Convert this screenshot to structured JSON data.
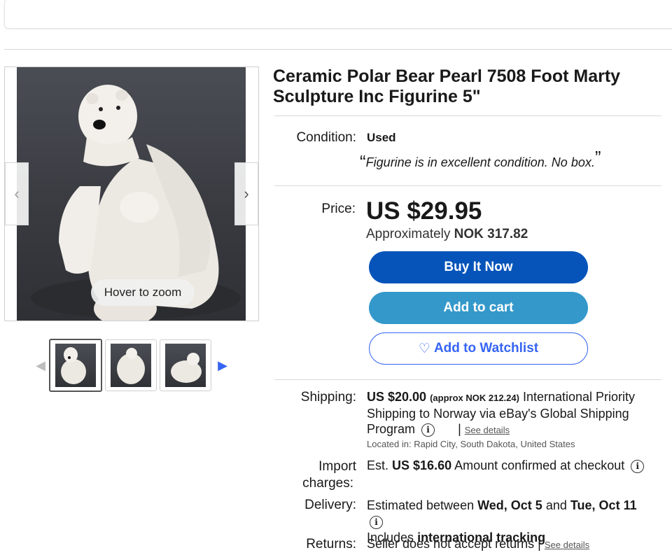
{
  "item": {
    "title": "Ceramic Polar Bear Pearl 7508 Foot Marty Sculpture Inc Figurine 5\""
  },
  "gallery": {
    "zoom_hint": "Hover to zoom",
    "prev_icon": "chevron-left-icon",
    "next_icon": "chevron-right-icon",
    "thumbnail_count": 3
  },
  "condition": {
    "label": "Condition:",
    "value": "Used",
    "note": "Figurine is in excellent condition. No box.",
    "open_quote": "“",
    "close_quote": "”"
  },
  "price": {
    "label": "Price:",
    "amount": "US $29.95",
    "approx_prefix": "Approximately",
    "approx_value": "NOK 317.82"
  },
  "buttons": {
    "buy_now": "Buy It Now",
    "add_to_cart": "Add to cart",
    "add_to_watchlist": "Add to Watchlist"
  },
  "shipping": {
    "label": "Shipping:",
    "amount": "US $20.00",
    "approx": "(approx NOK 212.24)",
    "service": "International Priority Shipping to Norway via eBay's Global Shipping Program",
    "see_details": "See details",
    "separator": "|",
    "location": "Located in: Rapid City, South Dakota, United States"
  },
  "import_charges": {
    "label_line1": "Import",
    "label_line2": "charges:",
    "est_prefix": "Est.",
    "amount": "US $16.60",
    "suffix": "Amount confirmed at checkout"
  },
  "delivery": {
    "label": "Delivery:",
    "prefix": "Estimated between",
    "start": "Wed, Oct 5",
    "and": "and",
    "end": "Tue, Oct 11",
    "tracking_prefix": "Includes",
    "tracking": "international tracking"
  },
  "returns": {
    "label": "Returns:",
    "text": "Seller does not accept returns",
    "separator": "|",
    "see_details": "See details"
  },
  "colors": {
    "buy_now_bg": "#0654ba",
    "cart_bg": "#3498ca",
    "watch_text": "#3665f3"
  }
}
